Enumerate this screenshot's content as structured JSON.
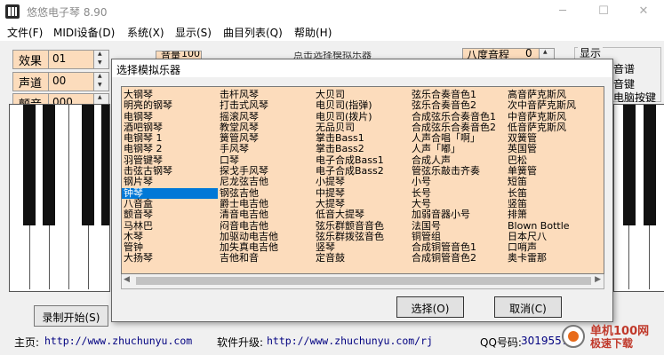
{
  "window": {
    "title": "悠悠电子琴 8.90",
    "minimize": "─",
    "maximize": "☐",
    "close": "✕"
  },
  "menu": [
    "文件(F)",
    "MIDI设备(D)",
    "系统(X)",
    "显示(S)",
    "曲目列表(Q)",
    "帮助(H)"
  ],
  "controls": {
    "effect": {
      "label": "效果",
      "value": "01"
    },
    "channel": {
      "label": "声道",
      "value": "00"
    },
    "vibrato": {
      "label": "颤音",
      "value": "000"
    },
    "volume_label": "音量",
    "volume_value": "100",
    "octave_label": "八度音程",
    "octave_value": "0",
    "center_text": "点击选择模拟乐器",
    "display_group": "显示",
    "display_opt1": "音谱",
    "display_opt2": "音键",
    "display_opt3": "电脑按键"
  },
  "bottom": {
    "record_button": "录制开始(S)",
    "homepage_label": "主页:",
    "homepage_url": "http://www.zhuchunyu.com",
    "upgrade_label": "软件升级:",
    "upgrade_url": "http://www.zhuchunyu.com/rj",
    "qq_label": "QQ号码:",
    "qq_value": "30195576"
  },
  "dialog": {
    "title": "选择模拟乐器",
    "select_button": "选择(O)",
    "cancel_button": "取消(C)",
    "selected_index": 9,
    "columns": [
      [
        "大钢琴",
        "明亮的钢琴",
        "电钢琴",
        "酒吧钢琴",
        "电钢琴 1",
        "电钢琴 2",
        "羽管键琴",
        "击弦古钢琴",
        "钢片琴",
        "钟琴",
        "八音盒",
        "颤音琴",
        "马林巴",
        "木琴",
        "管钟",
        "大扬琴"
      ],
      [
        "击杆风琴",
        "打击式风琴",
        "摇滚风琴",
        "教堂风琴",
        "簧管风琴",
        "手风琴",
        "口琴",
        "探戈手风琴",
        "尼龙弦吉他",
        "钢弦吉他",
        "爵士电吉他",
        "清音电吉他",
        "闷音电吉他",
        "加驱动电吉他",
        "加失真电吉他",
        "吉他和音"
      ],
      [
        "大贝司",
        "电贝司(指弹)",
        "电贝司(拨片)",
        "无品贝司",
        "掌击Bass1",
        "掌击Bass2",
        "电子合成Bass1",
        "电子合成Bass2",
        "小提琴",
        "中提琴",
        "大提琴",
        "低音大提琴",
        "弦乐群颤音音色",
        "弦乐群拨弦音色",
        "竖琴",
        "定音鼓"
      ],
      [
        "弦乐合奏音色1",
        "弦乐合奏音色2",
        "合成弦乐合奏音色1",
        "合成弦乐合奏音色2",
        "人声合唱「啊」",
        "人声「嘟」",
        "合成人声",
        "管弦乐敲击齐奏",
        "小号",
        "长号",
        "大号",
        "加弱音器小号",
        "法国号",
        "铜管组",
        "合成铜管音色1",
        "合成铜管音色2"
      ],
      [
        "高音萨克斯风",
        "次中音萨克斯风",
        "中音萨克斯风",
        "低音萨克斯风",
        "双簧管",
        "英国管",
        "巴松",
        "单簧管",
        "短笛",
        "长笛",
        "竖笛",
        "排箫",
        "Blown Bottle",
        "日本尺八",
        "口哨声",
        "奥卡雷那"
      ]
    ]
  },
  "watermark": {
    "line1": "单机100网",
    "line2": "极速下载"
  },
  "colors": {
    "list_bg": "#fcdcbc",
    "selection": "#0078d7"
  }
}
